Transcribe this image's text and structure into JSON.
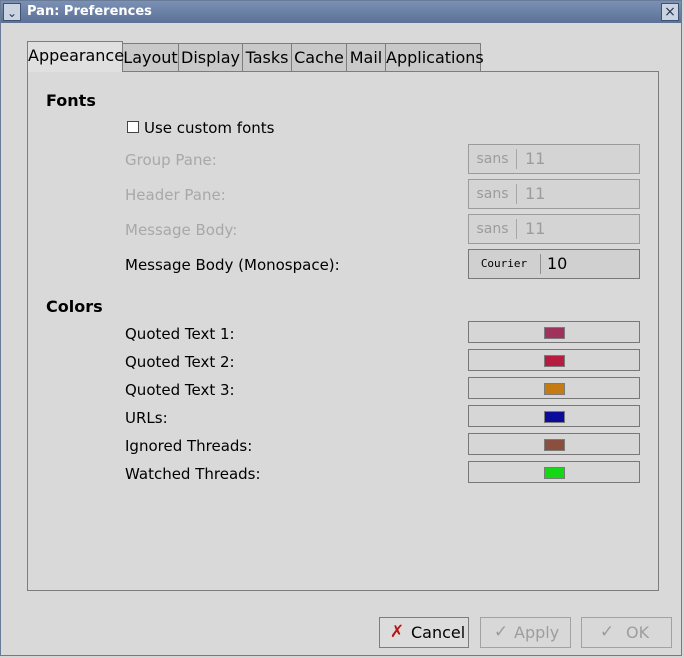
{
  "window": {
    "title": "Pan: Preferences"
  },
  "tabs": [
    {
      "label": "Appearance",
      "active": true
    },
    {
      "label": "Layout",
      "active": false
    },
    {
      "label": "Display",
      "active": false
    },
    {
      "label": "Tasks",
      "active": false
    },
    {
      "label": "Cache",
      "active": false
    },
    {
      "label": "Mail",
      "active": false
    },
    {
      "label": "Applications",
      "active": false
    }
  ],
  "fonts_section": {
    "title": "Fonts",
    "use_custom_fonts": {
      "label": "Use custom fonts",
      "checked": false
    },
    "rows": [
      {
        "label": "Group Pane:",
        "font": "sans",
        "size": "11",
        "enabled": false
      },
      {
        "label": "Header Pane:",
        "font": "sans",
        "size": "11",
        "enabled": false
      },
      {
        "label": "Message Body:",
        "font": "sans",
        "size": "11",
        "enabled": false
      },
      {
        "label": "Message Body (Monospace):",
        "font": "Courier",
        "size": "10",
        "enabled": true
      }
    ]
  },
  "colors_section": {
    "title": "Colors",
    "rows": [
      {
        "label": "Quoted Text 1:",
        "color": "#a0315d"
      },
      {
        "label": "Quoted Text 2:",
        "color": "#b61c3f"
      },
      {
        "label": "Quoted Text 3:",
        "color": "#c57a12"
      },
      {
        "label": "URLs:",
        "color": "#0b0c9a"
      },
      {
        "label": "Ignored Threads:",
        "color": "#8a4f3f"
      },
      {
        "label": "Watched Threads:",
        "color": "#14d814"
      }
    ]
  },
  "buttons": {
    "cancel": {
      "label": "Cancel",
      "enabled": true
    },
    "apply": {
      "label": "Apply",
      "enabled": false
    },
    "ok": {
      "label": "OK",
      "enabled": false
    }
  },
  "icons": {
    "window_menu": "chevron-down-icon",
    "window_close": "close-icon",
    "cancel": "cancel-x-icon",
    "apply": "checkmark-icon",
    "ok": "checkmark-icon"
  }
}
